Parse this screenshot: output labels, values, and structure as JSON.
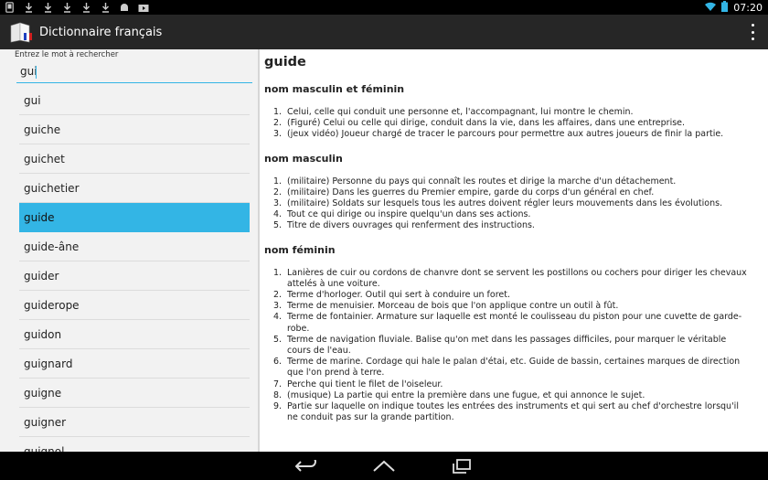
{
  "status_bar": {
    "time": "07:20",
    "left_icons": [
      "phone-icon",
      "download-icon",
      "download-icon",
      "download-icon",
      "download-icon",
      "download-icon",
      "android-icon",
      "play-store-icon"
    ]
  },
  "app": {
    "title": "Dictionnaire français"
  },
  "search": {
    "label": "Entrez le mot à rechercher",
    "value": "gui",
    "placeholder": ""
  },
  "word_list": [
    {
      "label": "gui",
      "selected": false
    },
    {
      "label": "guiche",
      "selected": false
    },
    {
      "label": "guichet",
      "selected": false
    },
    {
      "label": "guichetier",
      "selected": false
    },
    {
      "label": "guide",
      "selected": true
    },
    {
      "label": "guide-âne",
      "selected": false
    },
    {
      "label": "guider",
      "selected": false
    },
    {
      "label": "guiderope",
      "selected": false
    },
    {
      "label": "guidon",
      "selected": false
    },
    {
      "label": "guignard",
      "selected": false
    },
    {
      "label": "guigne",
      "selected": false
    },
    {
      "label": "guigner",
      "selected": false
    },
    {
      "label": "guignol",
      "selected": false
    }
  ],
  "definition": {
    "headword": "guide",
    "sections": [
      {
        "title": "nom masculin et féminin",
        "items": [
          "Celui, celle qui conduit une personne et, l'accompagnant, lui montre le chemin.",
          "(Figuré) Celui ou celle qui dirige, conduit dans la vie, dans les affaires, dans une entreprise.",
          "(jeux vidéo) Joueur chargé de tracer le parcours pour permettre aux autres joueurs de finir la partie."
        ]
      },
      {
        "title": "nom masculin",
        "items": [
          "(militaire) Personne du pays qui connaît les routes et dirige la marche d'un détachement.",
          "(militaire) Dans les guerres du Premier empire, garde du corps d'un général en chef.",
          "(militaire) Soldats sur lesquels tous les autres doivent régler leurs mouvements dans les évolutions.",
          "Tout ce qui dirige ou inspire quelqu'un dans ses actions.",
          "Titre de divers ouvrages qui renferment des instructions."
        ]
      },
      {
        "title": "nom féminin",
        "items": [
          "Lanières de cuir ou cordons de chanvre dont se servent les postillons ou cochers pour diriger les chevaux attelés à une voiture.",
          "Terme d'horloger. Outil qui sert à conduire un foret.",
          "Terme de menuisier. Morceau de bois que l'on applique contre un outil à fût.",
          "Terme de fontainier. Armature sur laquelle est monté le coulisseau du piston pour une cuvette de garde-robe.",
          "Terme de navigation fluviale. Balise qu'on met dans les passages difficiles, pour marquer le véritable cours de l'eau.",
          "Terme de marine. Cordage qui hale le palan d'étai, etc. Guide de bassin, certaines marques de direction que l'on prend à terre.",
          "Perche qui tient le filet de l'oiseleur.",
          "(musique) La partie qui entre la première dans une fugue, et qui annonce le sujet.",
          "Partie sur laquelle on indique toutes les entrées des instruments et qui sert au chef d'orchestre lorsqu'il ne conduit pas sur la grande partition."
        ]
      }
    ]
  },
  "colors": {
    "accent": "#33b5e5",
    "action_bar": "#262626",
    "list_bg": "#f2f2f2"
  }
}
